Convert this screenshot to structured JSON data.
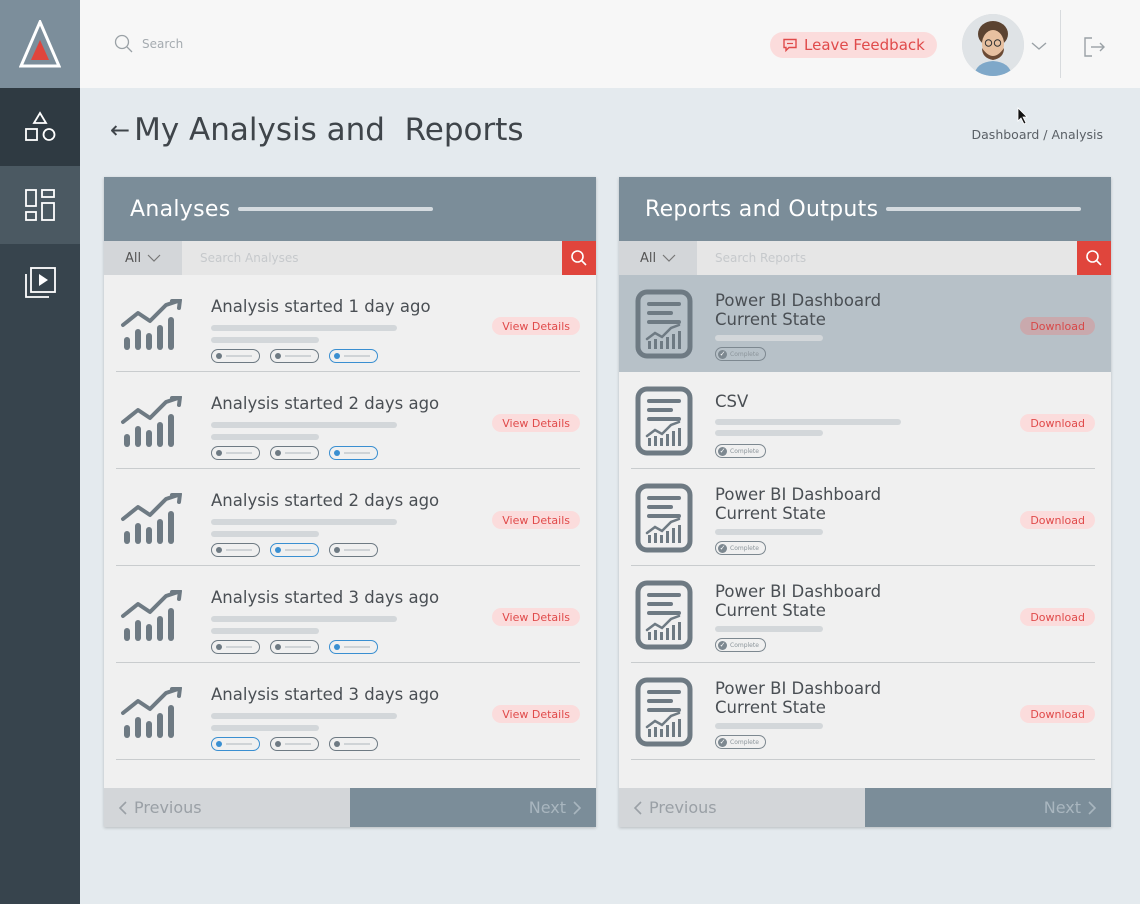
{
  "topbar": {
    "search_placeholder": "Search",
    "feedback_label": "Leave Feedback"
  },
  "page": {
    "title": "My Analysis and  Reports",
    "breadcrumb": "Dashboard / Analysis"
  },
  "analyses": {
    "title": "Analyses",
    "filter_label": "All",
    "search_placeholder": "Search Analyses",
    "action_label": "View Details",
    "items": [
      {
        "title": "Analysis started 1 day ago",
        "tags_active": [
          false,
          false,
          true
        ]
      },
      {
        "title": "Analysis started 2 days ago",
        "tags_active": [
          false,
          false,
          true
        ]
      },
      {
        "title": "Analysis started 2 days ago",
        "tags_active": [
          false,
          true,
          false
        ]
      },
      {
        "title": "Analysis started 3 days ago",
        "tags_active": [
          false,
          false,
          true
        ]
      },
      {
        "title": "Analysis started 3 days ago",
        "tags_active": [
          true,
          false,
          false
        ]
      }
    ],
    "prev_label": "Previous",
    "next_label": "Next"
  },
  "reports": {
    "title": "Reports and Outputs",
    "filter_label": "All",
    "search_placeholder": "Search Reports",
    "action_label": "Download",
    "badge_label": "Complete",
    "items": [
      {
        "title": "Power BI Dashboard Current State",
        "selected": true
      },
      {
        "title": "CSV",
        "selected": false
      },
      {
        "title": "Power BI Dashboard Current State",
        "selected": false
      },
      {
        "title": "Power BI Dashboard Current State",
        "selected": false
      },
      {
        "title": "Power BI Dashboard Current State",
        "selected": false
      }
    ],
    "prev_label": "Previous",
    "next_label": "Next"
  },
  "colors": {
    "sidebar": "#37444d",
    "panel_header": "#7b8d99",
    "accent_red": "#e0453c",
    "accent_blue": "#3a8fd1"
  }
}
